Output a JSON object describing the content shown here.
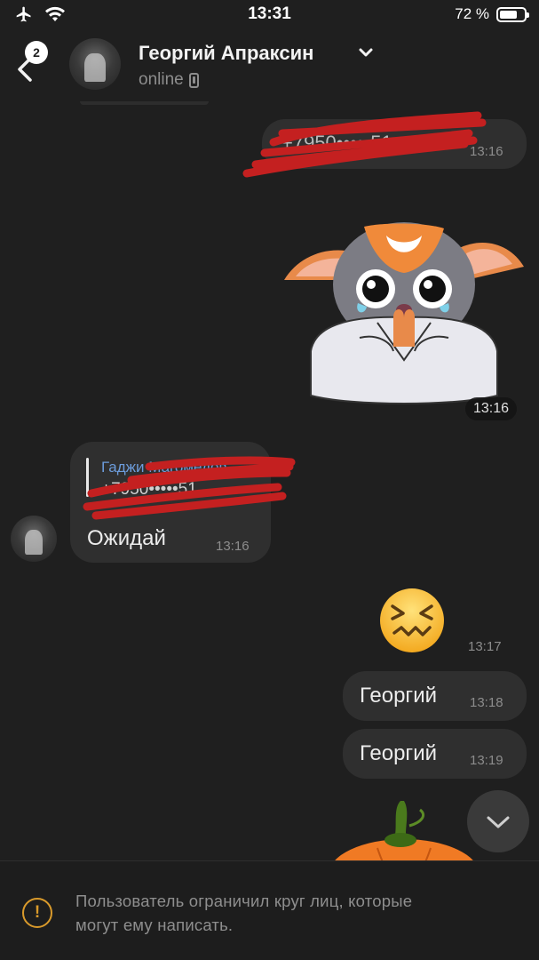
{
  "status_bar": {
    "time": "13:31",
    "battery_text": "72 %",
    "battery_level": 0.72
  },
  "header": {
    "back_badge": "2",
    "contact_name": "Георгий Апраксин",
    "contact_status": "online"
  },
  "messages": [
    {
      "side": "out",
      "type": "text",
      "text": "+7950•••••51",
      "time": "13:16",
      "redacted": true
    },
    {
      "side": "out",
      "type": "sticker",
      "sticker": "crying-cat-praying",
      "time": "13:16"
    },
    {
      "side": "in",
      "type": "reply",
      "reply_name": "Гаджи Магомедов",
      "reply_text": "+7950•••••51",
      "text": "Ожидай",
      "time": "13:16"
    },
    {
      "side": "out",
      "type": "emoji",
      "emoji": "confounded-face",
      "time": "13:17"
    },
    {
      "side": "out",
      "type": "text",
      "text": "Георгий",
      "time": "13:18"
    },
    {
      "side": "out",
      "type": "text",
      "text": "Георгий",
      "time": "13:19"
    },
    {
      "side": "out",
      "type": "sticker",
      "sticker": "pumpkin"
    }
  ],
  "bottom_bar": {
    "restriction_line1": "Пользователь ограничил круг лиц, которые",
    "restriction_line2": "могут ему написать."
  },
  "icons": {
    "back": "chevron-left-icon",
    "chevron": "chevron-down-icon",
    "scroll": "chevron-down-icon",
    "info": "exclamation-circle-icon"
  },
  "colors": {
    "background": "#1f1f1f",
    "bubble": "#2f2f2f",
    "redaction": "#c42020",
    "reply_name": "#6c9cdb",
    "warning": "#d99a2b"
  }
}
